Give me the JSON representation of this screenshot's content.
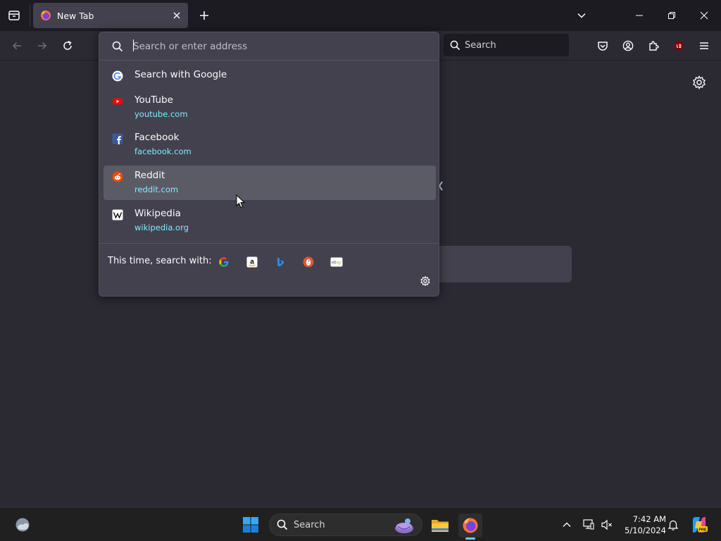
{
  "tabs": [
    {
      "title": "New Tab"
    }
  ],
  "urlbar": {
    "placeholder": "Search or enter address"
  },
  "toolbar": {
    "search_placeholder": "Search"
  },
  "suggestions": [
    {
      "title": "Search with Google",
      "url": "",
      "icon": "google-icon"
    },
    {
      "title": "YouTube",
      "url": "youtube.com",
      "icon": "youtube-icon"
    },
    {
      "title": "Facebook",
      "url": "facebook.com",
      "icon": "facebook-icon"
    },
    {
      "title": "Reddit",
      "url": "reddit.com",
      "icon": "reddit-icon",
      "selected": true
    },
    {
      "title": "Wikipedia",
      "url": "wikipedia.org",
      "icon": "wikipedia-icon"
    }
  ],
  "one_offs": {
    "label": "This time, search with:",
    "engines": [
      "Google",
      "Amazon",
      "Bing",
      "DuckDuckGo",
      "eBay"
    ]
  },
  "taskbar": {
    "search_label": "Search",
    "time": "7:42 AM",
    "date": "5/10/2024"
  },
  "colors": {
    "url_text": "#80ebff",
    "panel_bg": "#42414d",
    "selected_bg": "#5b5b66",
    "page_bg": "#2b2a33",
    "tab_strip_bg": "#1c1b22"
  }
}
